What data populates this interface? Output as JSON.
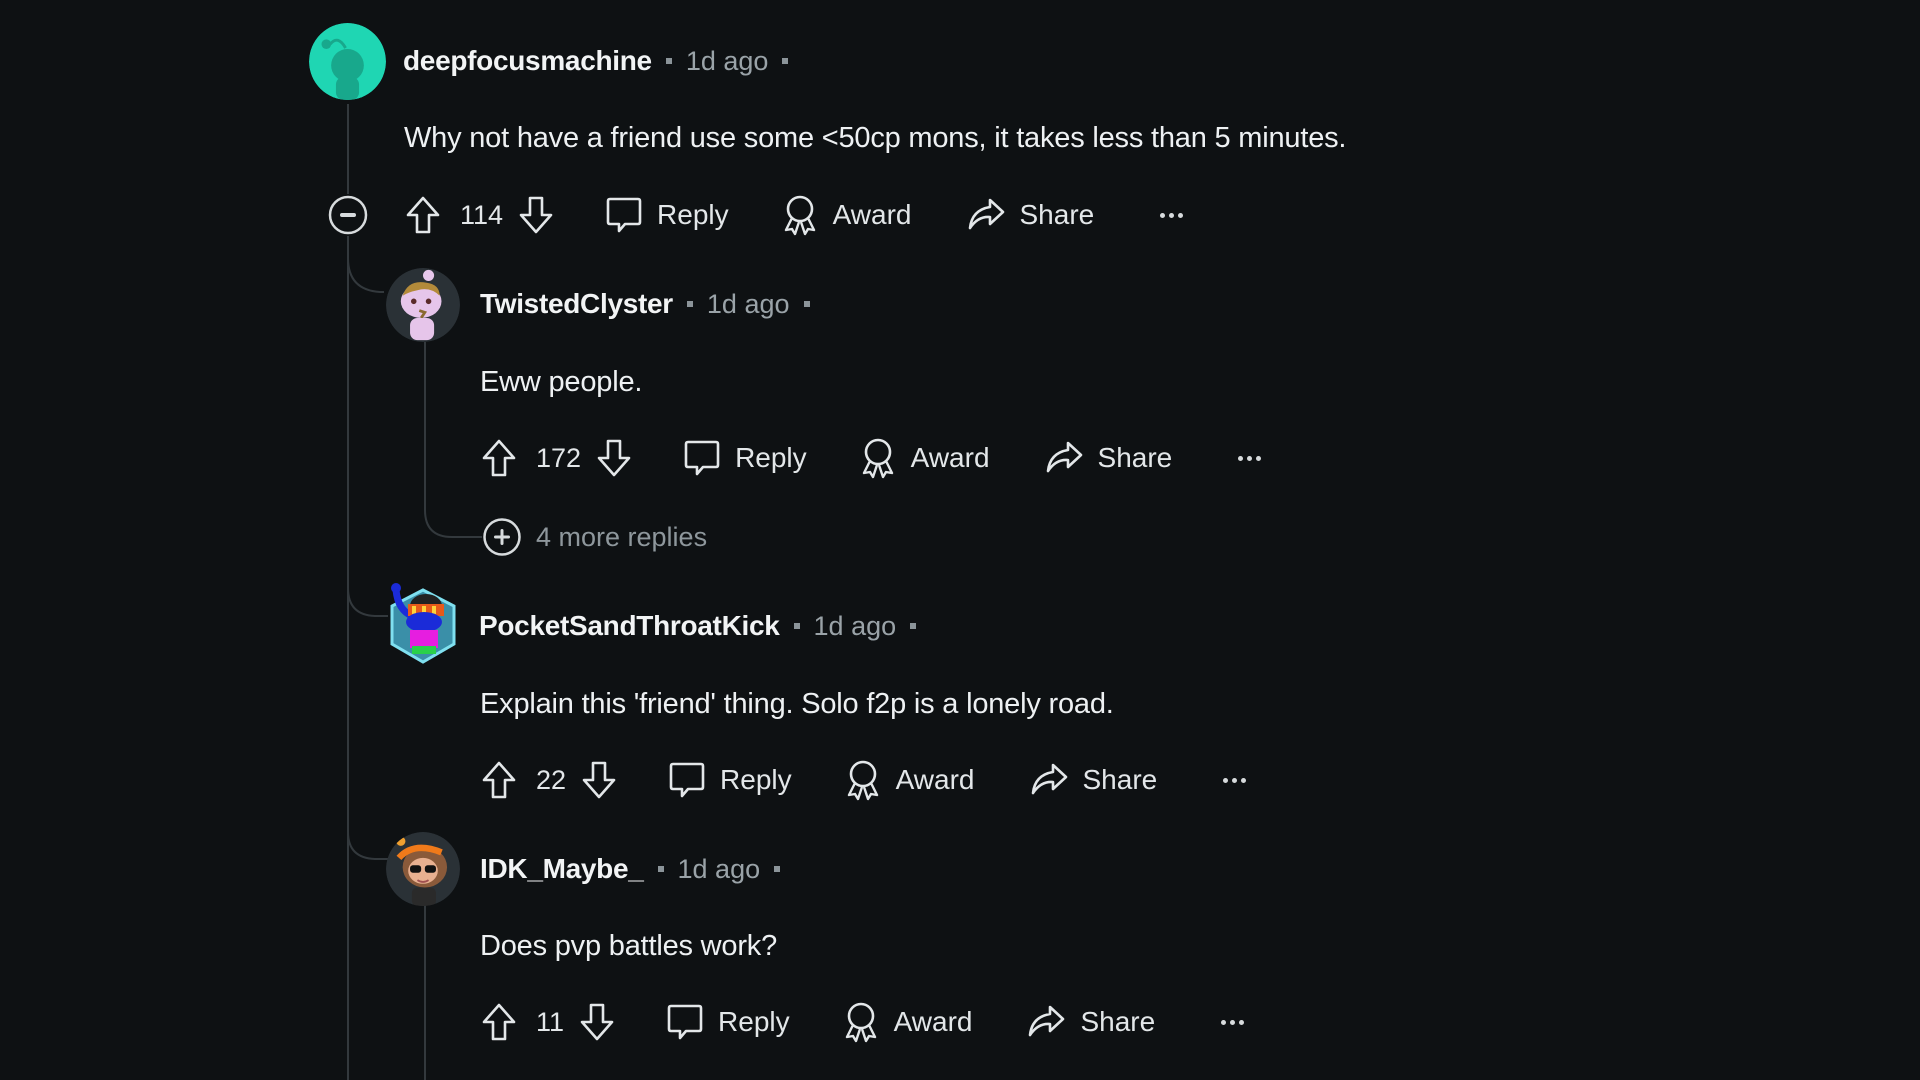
{
  "theme": {
    "background": "#0e1113",
    "text": "#eef1f3",
    "meta_text": "#9aa3a8",
    "thread_line": "#33393d"
  },
  "comments": [
    {
      "username": "deepfocusmachine",
      "time": "1d ago",
      "avatar": "default-snoo-teal",
      "body": "Why not have a friend use some <50cp mons, it takes less than 5 minutes.",
      "votes": "114",
      "actions": {
        "reply": "Reply",
        "award": "Award",
        "share": "Share"
      },
      "collapse_icon": "collapse-minus-icon"
    },
    {
      "username": "TwistedClyster",
      "time": "1d ago",
      "avatar": "snoo-pink-with-hair",
      "body": "Eww people.",
      "votes": "172",
      "actions": {
        "reply": "Reply",
        "award": "Award",
        "share": "Share"
      },
      "more_replies": "4 more replies"
    },
    {
      "username": "PocketSandThroatKick",
      "time": "1d ago",
      "avatar": "nft-hex-snoo",
      "body": "Explain this 'friend' thing. Solo f2p is a lonely road.",
      "votes": "22",
      "actions": {
        "reply": "Reply",
        "award": "Award",
        "share": "Share"
      }
    },
    {
      "username": "IDK_Maybe_",
      "time": "1d ago",
      "avatar": "snoo-brown-hair-sunglasses",
      "body": "Does pvp battles work?",
      "votes": "11",
      "actions": {
        "reply": "Reply",
        "award": "Award",
        "share": "Share"
      }
    }
  ]
}
